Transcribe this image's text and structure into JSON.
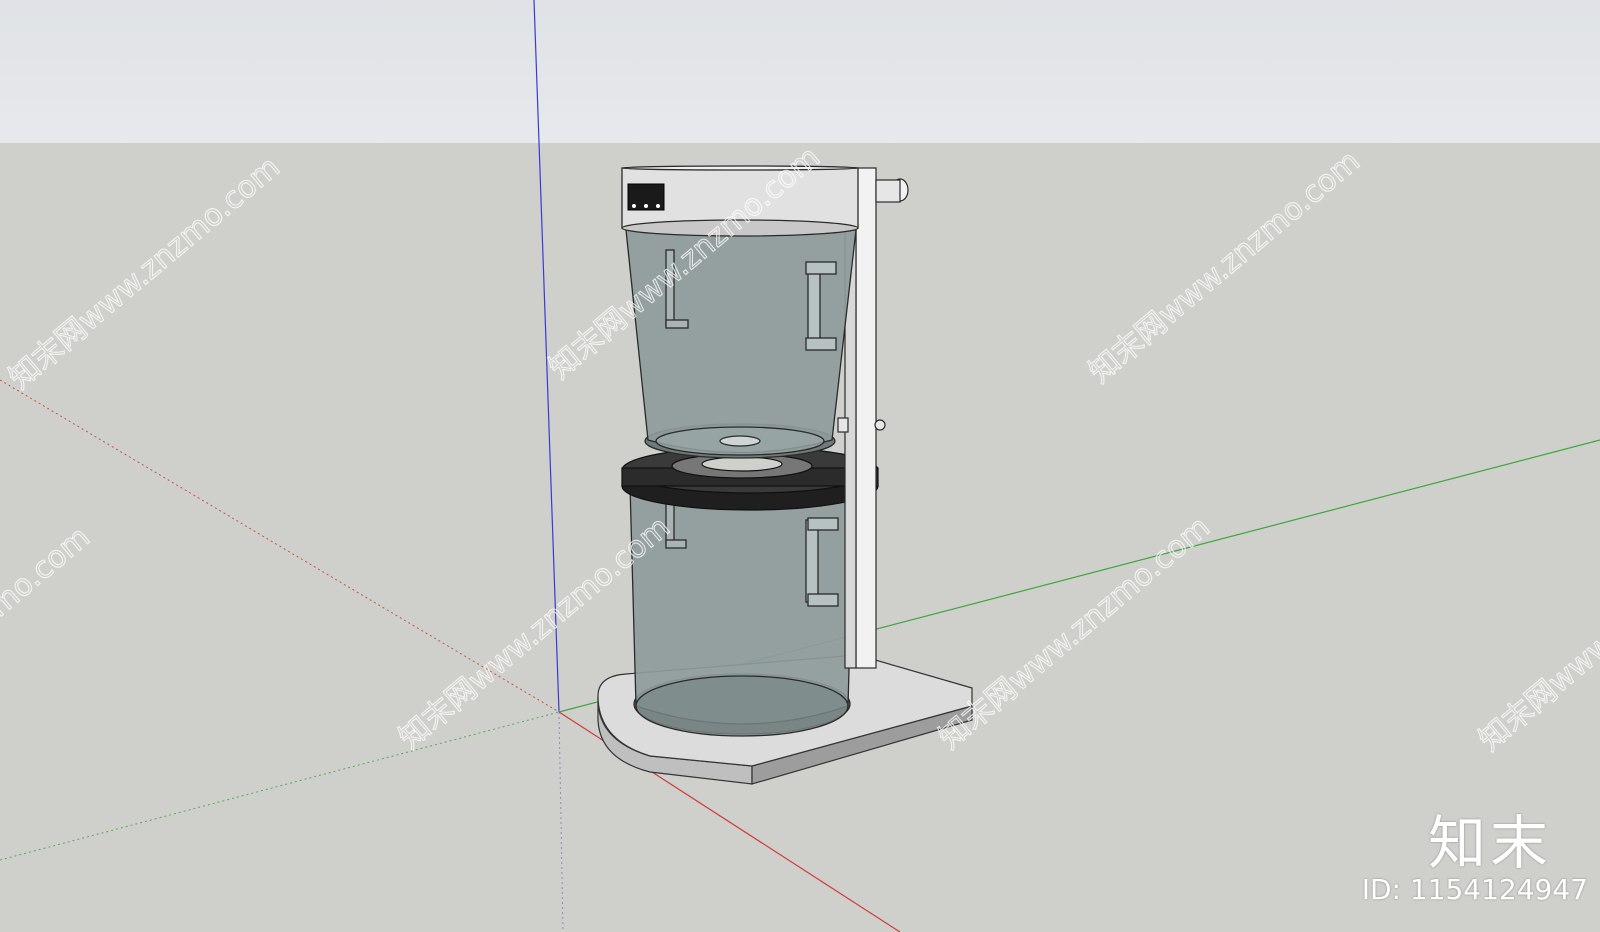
{
  "watermark": {
    "text": "知末网www.znzmo.com",
    "brand": "知末",
    "id_label": "ID: 1154124947"
  },
  "colors": {
    "sky": "#e4e6e9",
    "ground": "#cfd0cb",
    "axis_red": "#d23a3a",
    "axis_green": "#3fa63f",
    "axis_blue": "#3a3ad0",
    "glass": "#8e9b9b",
    "lid_black": "#2b2b2b",
    "body_white": "#f2f2f2"
  }
}
